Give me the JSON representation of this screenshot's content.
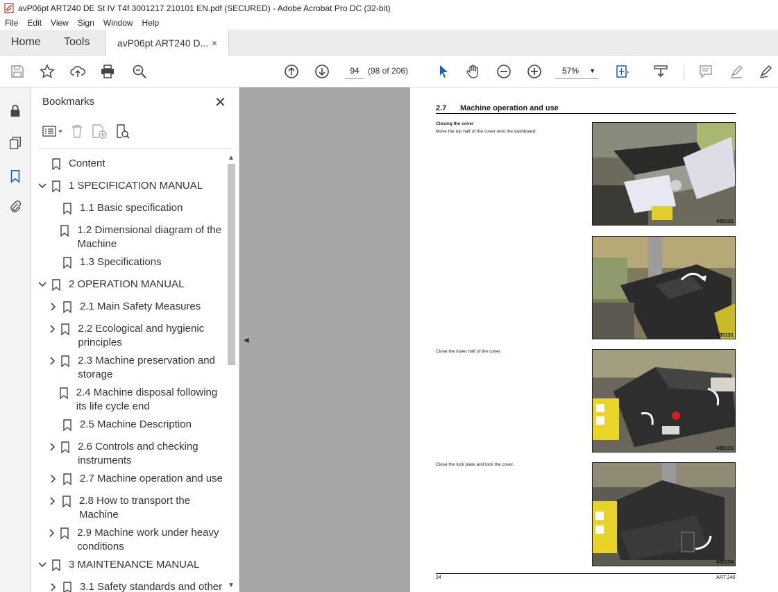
{
  "window": {
    "title": "avP06pt ART240 DE St IV T4f 3001217 210101 EN.pdf (SECURED) - Adobe Acrobat Pro DC (32-bit)"
  },
  "menu": [
    "File",
    "Edit",
    "View",
    "Sign",
    "Window",
    "Help"
  ],
  "tabs": {
    "home": "Home",
    "tools": "Tools",
    "document": "avP06pt ART240 D...",
    "close": "×"
  },
  "toolbar": {
    "page_number": "94",
    "page_of": "(98 of 206)",
    "zoom": "57%",
    "icons": [
      "save-icon",
      "star-icon",
      "upload-icon",
      "print-icon",
      "zoom-search-icon",
      "page-up-icon",
      "page-down-icon",
      "select-cursor-icon",
      "hand-icon",
      "zoom-out-icon",
      "zoom-in-icon",
      "fit-page-icon",
      "scroll-mode-icon",
      "comment-icon",
      "highlight-icon",
      "sign-icon"
    ]
  },
  "panel": {
    "title": "Bookmarks",
    "bookmarks": [
      {
        "label": "Content",
        "level": 0,
        "expander": "none"
      },
      {
        "label": "1 SPECIFICATION MANUAL",
        "level": 0,
        "expander": "expanded"
      },
      {
        "label": "1.1 Basic specification",
        "level": 1,
        "expander": "none"
      },
      {
        "label": "1.2 Dimensional diagram of the Machine",
        "level": 1,
        "expander": "none"
      },
      {
        "label": "1.3 Specifications",
        "level": 1,
        "expander": "none"
      },
      {
        "label": "2 OPERATION MANUAL",
        "level": 0,
        "expander": "expanded"
      },
      {
        "label": "2.1 Main Safety Measures",
        "level": 1,
        "expander": "collapsed"
      },
      {
        "label": "2.2 Ecological and hygienic principles",
        "level": 1,
        "expander": "collapsed"
      },
      {
        "label": "2.3 Machine preservation and storage",
        "level": 1,
        "expander": "collapsed"
      },
      {
        "label": "2.4 Machine disposal following its life cycle end",
        "level": 1,
        "expander": "none"
      },
      {
        "label": "2.5 Machine Description",
        "level": 1,
        "expander": "none"
      },
      {
        "label": "2.6 Controls and checking instruments",
        "level": 1,
        "expander": "collapsed"
      },
      {
        "label": "2.7 Machine operation and use",
        "level": 1,
        "expander": "collapsed"
      },
      {
        "label": "2.8 How to transport the Machine",
        "level": 1,
        "expander": "collapsed"
      },
      {
        "label": "2.9 Machine work under heavy conditions",
        "level": 1,
        "expander": "collapsed"
      },
      {
        "label": "3 MAINTENANCE MANUAL",
        "level": 0,
        "expander": "expanded"
      },
      {
        "label": "3.1 Safety standards and other",
        "level": 1,
        "expander": "collapsed"
      }
    ]
  },
  "document": {
    "section_number": "2.7",
    "section_title": "Machine operation and use",
    "step1_heading": "Closing the cover",
    "step1_text": "Move the top half of the cover onto the dashboard.",
    "step2_text": "Close the lower half of the cover.",
    "step3_text": "Close the lock plate and lock the cover.",
    "photos": [
      "435132",
      "435131",
      "435133",
      "435134"
    ],
    "footer_left": "94",
    "footer_right": "ART 240"
  }
}
